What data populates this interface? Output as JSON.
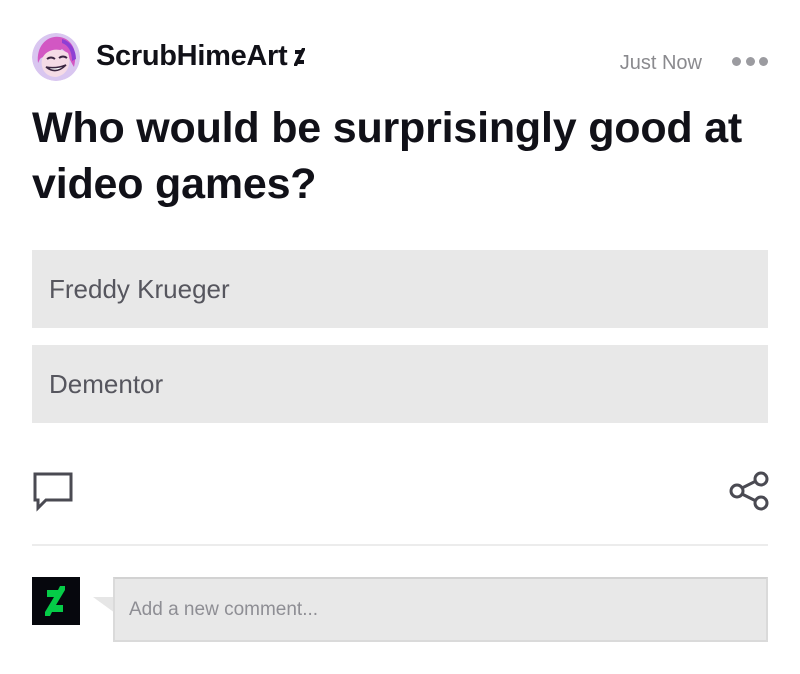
{
  "post": {
    "username": "ScrubHimeArt",
    "timestamp": "Just Now",
    "title": "Who would be surprisingly good at video games?"
  },
  "poll": {
    "options": [
      "Freddy Krueger",
      "Dementor"
    ]
  },
  "comment": {
    "placeholder": "Add a new comment..."
  },
  "colors": {
    "brand_green": "#05cc47",
    "option_bg": "#e8e8e8",
    "title_text": "#111118"
  },
  "icons": [
    "avatar",
    "deviantart-badge-icon",
    "more-options-icon",
    "comment-icon",
    "share-icon",
    "deviantart-logo-icon"
  ]
}
